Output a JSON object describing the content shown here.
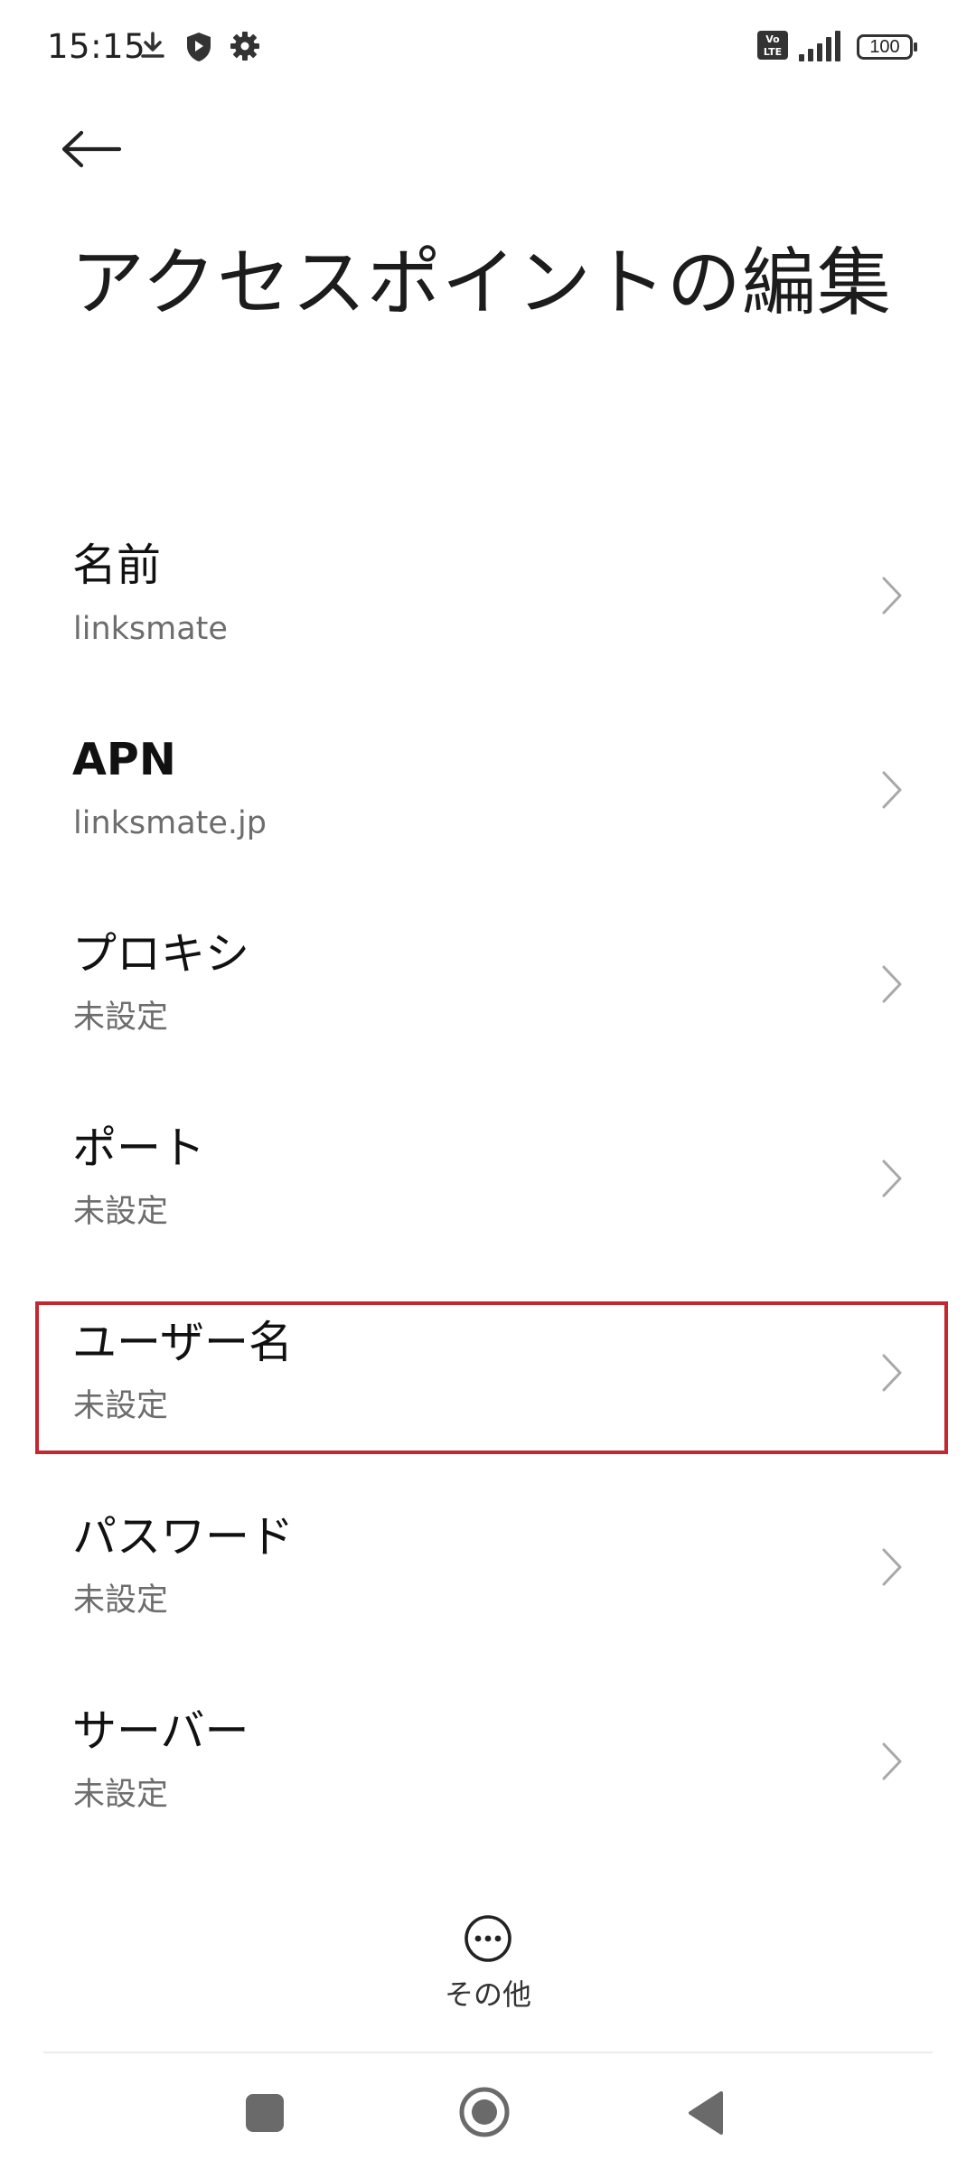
{
  "status_bar": {
    "time": "15:15",
    "battery": "100",
    "icons": [
      "download-icon",
      "shield-icon",
      "gear-icon",
      "volte-icon",
      "signal-icon",
      "battery-icon"
    ]
  },
  "page": {
    "title": "アクセスポイントの編集"
  },
  "settings": [
    {
      "label": "名前",
      "value": "linksmate"
    },
    {
      "label": "APN",
      "value": "linksmate.jp"
    },
    {
      "label": "プロキシ",
      "value": "未設定"
    },
    {
      "label": "ポート",
      "value": "未設定"
    },
    {
      "label": "ユーザー名",
      "value": "未設定"
    },
    {
      "label": "パスワード",
      "value": "未設定"
    },
    {
      "label": "サーバー",
      "value": "未設定"
    }
  ],
  "more": {
    "label": "その他"
  },
  "colors": {
    "highlight": "#c4272f",
    "secondary_text": "#6d6d6d"
  }
}
